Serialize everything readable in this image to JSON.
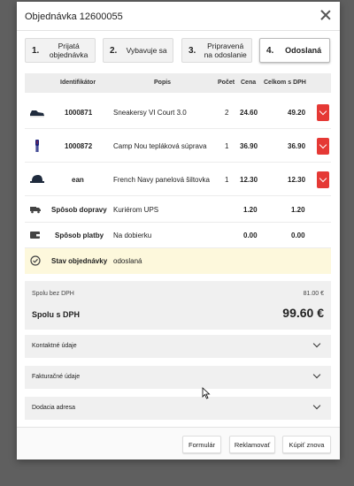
{
  "modal": {
    "title": "Objednávka 12600055"
  },
  "steps": [
    {
      "num": "1.",
      "label": "Prijatá objednávka",
      "active": false
    },
    {
      "num": "2.",
      "label": "Vybavuje sa",
      "active": false
    },
    {
      "num": "3.",
      "label": "Pripravená na odoslanie",
      "active": false
    },
    {
      "num": "4.",
      "label": "Odoslaná",
      "active": true
    }
  ],
  "table": {
    "headers": {
      "id": "Identifikátor",
      "desc": "Popis",
      "qty": "Počet",
      "price": "Cena",
      "total": "Celkom s DPH"
    },
    "rows": [
      {
        "icon": "sneaker-icon",
        "id": "1000871",
        "desc": "Sneakersy VI Court 3.0",
        "qty": "2",
        "price": "24.60",
        "total": "49.20"
      },
      {
        "icon": "tracksuit-icon",
        "id": "1000872",
        "desc": "Camp Nou tepláková súprava",
        "qty": "1",
        "price": "36.90",
        "total": "36.90"
      },
      {
        "icon": "cap-icon",
        "id": "ean",
        "desc": "French Navy panelová šiltovka",
        "qty": "1",
        "price": "12.30",
        "total": "12.30"
      }
    ],
    "shipping": {
      "label": "Spôsob dopravy",
      "value": "Kuriérom UPS",
      "price": "1.20",
      "total": "1.20"
    },
    "payment": {
      "label": "Spôsob platby",
      "value": "Na dobierku",
      "price": "0.00",
      "total": "0.00"
    },
    "status": {
      "label": "Stav objednávky",
      "value": "odoslaná"
    }
  },
  "summary": {
    "without_vat_label": "Spolu bez DPH",
    "without_vat_value": "81.00 €",
    "with_vat_label": "Spolu s DPH",
    "with_vat_value": "99.60 €"
  },
  "accordions": [
    "Kontaktné údaje",
    "Fakturačné údaje",
    "Dodacia adresa"
  ],
  "footer": {
    "form": "Formulár",
    "claim": "Reklamovať",
    "buy_again": "Kúpiť znova"
  },
  "colors": {
    "accent_red": "#e53935",
    "status_bg": "#fdf8dc"
  }
}
